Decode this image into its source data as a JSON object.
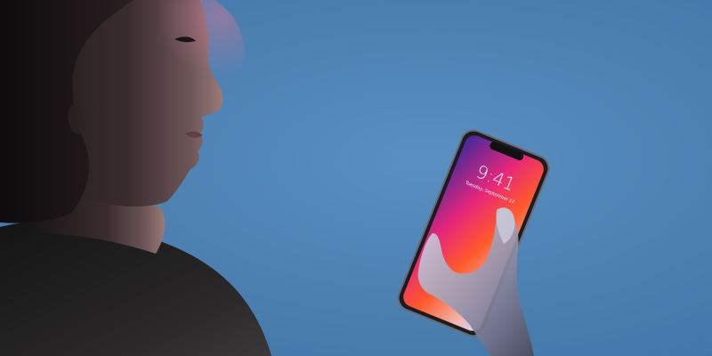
{
  "scene": {
    "subject": "woman-looking-at-smartphone",
    "background_color": "#4b7fb0",
    "wallpaper_colors": [
      "#e6267a",
      "#ff5a2a",
      "#3b2a9e",
      "#6a8cff"
    ]
  },
  "phone": {
    "time": "9:41",
    "date": "Tuesday, September 12"
  }
}
